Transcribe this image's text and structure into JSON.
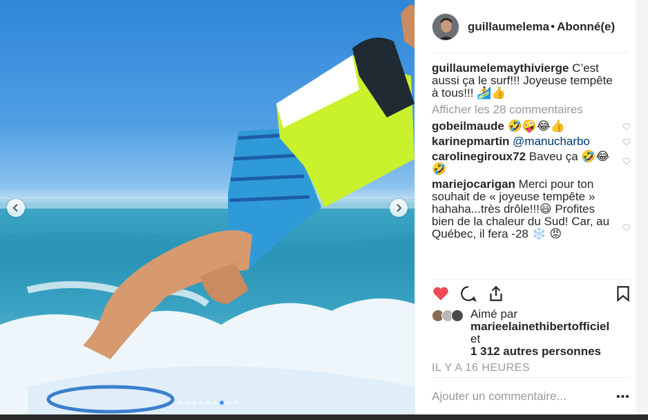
{
  "post": {
    "username": "guillaumelemaythivierge",
    "header_username": "guillaumelema",
    "separator": "•",
    "follow_status": "Abonné(e)",
    "caption": "C’est aussi ça le surf!!! Joyeuse tempête à tous!!! 🏄👍"
  },
  "comments": {
    "view_all": "Afficher les 28 commentaires",
    "items": [
      {
        "user": "gobeilmaude",
        "text": " 🤣🤪😂👍"
      },
      {
        "user": "karinepmartin",
        "text": " ",
        "mention": "@manucharbo"
      },
      {
        "user": "carolinegiroux72",
        "text": " Baveu ça 🤣😂🤣"
      },
      {
        "user": "mariejocarigan",
        "text": " Merci pour ton souhait de «  joyeuse tempête » hahaha...très drôle!!!😃 Profites bien de la chaleur du Sud! Car, au Québec, il fera -28 ❄️ 😡"
      }
    ]
  },
  "actions": {
    "like_icon": "heart-filled-icon",
    "comment_icon": "comment-icon",
    "share_icon": "share-icon",
    "save_icon": "bookmark-icon",
    "like_color": "#ed4956"
  },
  "likes": {
    "prefix": "Aimé par",
    "user": "marieelainethibertofficiel",
    "connector": "et",
    "others": "1 312 autres personnes"
  },
  "timestamp": "IL Y A 16 HEURES",
  "add_comment_placeholder": "Ajouter un commentaire...",
  "more_options": "•••",
  "carousel": {
    "total": 9,
    "active": 7
  }
}
